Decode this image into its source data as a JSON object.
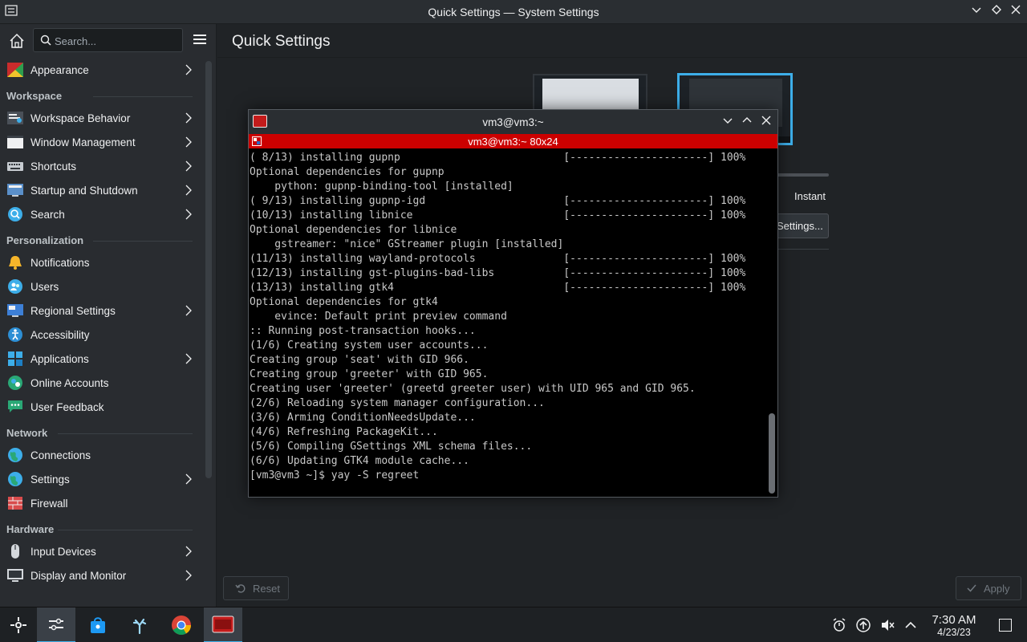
{
  "window": {
    "title": "Quick Settings — System Settings"
  },
  "sidebar": {
    "search_placeholder": "Search...",
    "items_top": [
      {
        "label": "Appearance",
        "icon": "appearance-icon",
        "chevron": true
      }
    ],
    "groups": [
      {
        "header": "Workspace",
        "items": [
          {
            "label": "Workspace Behavior",
            "icon": "workspace-behavior-icon",
            "chevron": true
          },
          {
            "label": "Window Management",
            "icon": "window-management-icon",
            "chevron": true
          },
          {
            "label": "Shortcuts",
            "icon": "keyboard-icon",
            "chevron": true
          },
          {
            "label": "Startup and Shutdown",
            "icon": "startup-icon",
            "chevron": true
          },
          {
            "label": "Search",
            "icon": "search-icon",
            "chevron": true
          }
        ]
      },
      {
        "header": "Personalization",
        "items": [
          {
            "label": "Notifications",
            "icon": "bell-icon",
            "chevron": false
          },
          {
            "label": "Users",
            "icon": "users-icon",
            "chevron": false
          },
          {
            "label": "Regional Settings",
            "icon": "regional-icon",
            "chevron": true
          },
          {
            "label": "Accessibility",
            "icon": "accessibility-icon",
            "chevron": false
          },
          {
            "label": "Applications",
            "icon": "applications-icon",
            "chevron": true
          },
          {
            "label": "Online Accounts",
            "icon": "online-accounts-icon",
            "chevron": false
          },
          {
            "label": "User Feedback",
            "icon": "feedback-icon",
            "chevron": false
          }
        ]
      },
      {
        "header": "Network",
        "items": [
          {
            "label": "Connections",
            "icon": "globe-icon",
            "chevron": false
          },
          {
            "label": "Settings",
            "icon": "globe-icon",
            "chevron": true
          },
          {
            "label": "Firewall",
            "icon": "firewall-icon",
            "chevron": false
          }
        ]
      },
      {
        "header": "Hardware",
        "items": [
          {
            "label": "Input Devices",
            "icon": "mouse-icon",
            "chevron": true
          },
          {
            "label": "Display and Monitor",
            "icon": "monitor-icon",
            "chevron": true
          }
        ]
      }
    ]
  },
  "main": {
    "page_title": "Quick Settings",
    "animation_speed_label": "Instant",
    "more_settings_button": "Settings...",
    "reset_button": "Reset",
    "apply_button": "Apply"
  },
  "terminal": {
    "window_title": "vm3@vm3:~",
    "tab_title": "vm3@vm3:~ 80x24",
    "lines": [
      "( 8/13) installing gupnp                          [----------------------] 100%",
      "Optional dependencies for gupnp",
      "    python: gupnp-binding-tool [installed]",
      "( 9/13) installing gupnp-igd                      [----------------------] 100%",
      "(10/13) installing libnice                        [----------------------] 100%",
      "Optional dependencies for libnice",
      "    gstreamer: \"nice\" GStreamer plugin [installed]",
      "(11/13) installing wayland-protocols              [----------------------] 100%",
      "(12/13) installing gst-plugins-bad-libs           [----------------------] 100%",
      "(13/13) installing gtk4                           [----------------------] 100%",
      "Optional dependencies for gtk4",
      "    evince: Default print preview command",
      ":: Running post-transaction hooks...",
      "(1/6) Creating system user accounts...",
      "Creating group 'seat' with GID 966.",
      "Creating group 'greeter' with GID 965.",
      "Creating user 'greeter' (greetd greeter user) with UID 965 and GID 965.",
      "(2/6) Reloading system manager configuration...",
      "(3/6) Arming ConditionNeedsUpdate...",
      "(4/6) Refreshing PackageKit...",
      "(5/6) Compiling GSettings XML schema files...",
      "(6/6) Updating GTK4 module cache...",
      "[vm3@vm3 ~]$ yay -S regreet"
    ]
  },
  "taskbar": {
    "time": "7:30 AM",
    "date": "4/23/23"
  },
  "colors": {
    "accent": "#3daee9",
    "terminal_tab": "#cc0000",
    "background": "#202326"
  }
}
